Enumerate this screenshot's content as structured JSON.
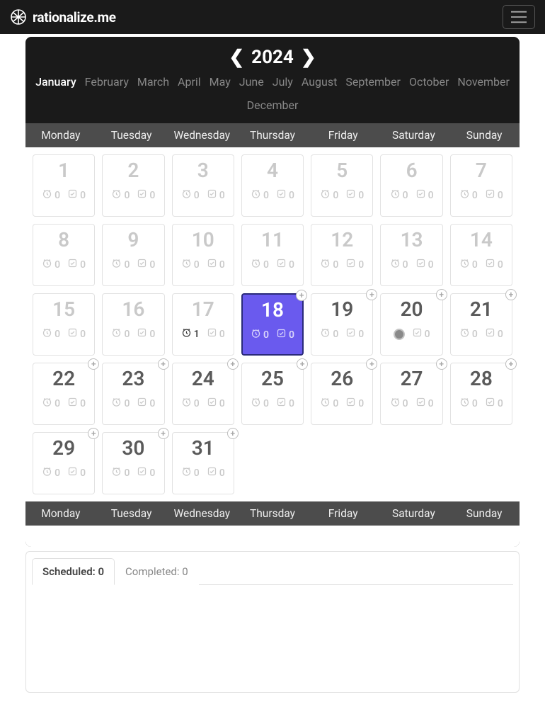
{
  "brand": "rationalize.me",
  "year": "2024",
  "months": [
    "January",
    "February",
    "March",
    "April",
    "May",
    "June",
    "July",
    "August",
    "September",
    "October",
    "November",
    "December"
  ],
  "active_month_index": 0,
  "weekdays": [
    "Monday",
    "Tuesday",
    "Wednesday",
    "Thursday",
    "Friday",
    "Saturday",
    "Sunday"
  ],
  "days": [
    {
      "n": 1,
      "sched": 0,
      "done": 0,
      "recent": false,
      "add": false,
      "special": null
    },
    {
      "n": 2,
      "sched": 0,
      "done": 0,
      "recent": false,
      "add": false,
      "special": null
    },
    {
      "n": 3,
      "sched": 0,
      "done": 0,
      "recent": false,
      "add": false,
      "special": null
    },
    {
      "n": 4,
      "sched": 0,
      "done": 0,
      "recent": false,
      "add": false,
      "special": null
    },
    {
      "n": 5,
      "sched": 0,
      "done": 0,
      "recent": false,
      "add": false,
      "special": null
    },
    {
      "n": 6,
      "sched": 0,
      "done": 0,
      "recent": false,
      "add": false,
      "special": null
    },
    {
      "n": 7,
      "sched": 0,
      "done": 0,
      "recent": false,
      "add": false,
      "special": null
    },
    {
      "n": 8,
      "sched": 0,
      "done": 0,
      "recent": false,
      "add": false,
      "special": null
    },
    {
      "n": 9,
      "sched": 0,
      "done": 0,
      "recent": false,
      "add": false,
      "special": null
    },
    {
      "n": 10,
      "sched": 0,
      "done": 0,
      "recent": false,
      "add": false,
      "special": null
    },
    {
      "n": 11,
      "sched": 0,
      "done": 0,
      "recent": false,
      "add": false,
      "special": null
    },
    {
      "n": 12,
      "sched": 0,
      "done": 0,
      "recent": false,
      "add": false,
      "special": null
    },
    {
      "n": 13,
      "sched": 0,
      "done": 0,
      "recent": false,
      "add": false,
      "special": null
    },
    {
      "n": 14,
      "sched": 0,
      "done": 0,
      "recent": false,
      "add": false,
      "special": null
    },
    {
      "n": 15,
      "sched": 0,
      "done": 0,
      "recent": false,
      "add": false,
      "special": null
    },
    {
      "n": 16,
      "sched": 0,
      "done": 0,
      "recent": false,
      "add": false,
      "special": null
    },
    {
      "n": 17,
      "sched": 1,
      "done": 0,
      "recent": false,
      "add": false,
      "special": "darksched"
    },
    {
      "n": 18,
      "sched": 0,
      "done": 0,
      "recent": false,
      "add": true,
      "special": "selected"
    },
    {
      "n": 19,
      "sched": 0,
      "done": 0,
      "recent": true,
      "add": true,
      "special": null
    },
    {
      "n": 20,
      "sched": null,
      "done": 0,
      "recent": true,
      "add": true,
      "special": "dot"
    },
    {
      "n": 21,
      "sched": 0,
      "done": 0,
      "recent": true,
      "add": true,
      "special": null
    },
    {
      "n": 22,
      "sched": 0,
      "done": 0,
      "recent": true,
      "add": true,
      "special": null
    },
    {
      "n": 23,
      "sched": 0,
      "done": 0,
      "recent": true,
      "add": true,
      "special": null
    },
    {
      "n": 24,
      "sched": 0,
      "done": 0,
      "recent": true,
      "add": true,
      "special": null
    },
    {
      "n": 25,
      "sched": 0,
      "done": 0,
      "recent": true,
      "add": true,
      "special": null
    },
    {
      "n": 26,
      "sched": 0,
      "done": 0,
      "recent": true,
      "add": true,
      "special": null
    },
    {
      "n": 27,
      "sched": 0,
      "done": 0,
      "recent": true,
      "add": true,
      "special": null
    },
    {
      "n": 28,
      "sched": 0,
      "done": 0,
      "recent": true,
      "add": true,
      "special": null
    },
    {
      "n": 29,
      "sched": 0,
      "done": 0,
      "recent": true,
      "add": true,
      "special": null
    },
    {
      "n": 30,
      "sched": 0,
      "done": 0,
      "recent": true,
      "add": true,
      "special": null
    },
    {
      "n": 31,
      "sched": 0,
      "done": 0,
      "recent": true,
      "add": true,
      "special": null
    }
  ],
  "tabs": {
    "scheduled_label": "Scheduled: 0",
    "completed_label": "Completed: 0"
  }
}
